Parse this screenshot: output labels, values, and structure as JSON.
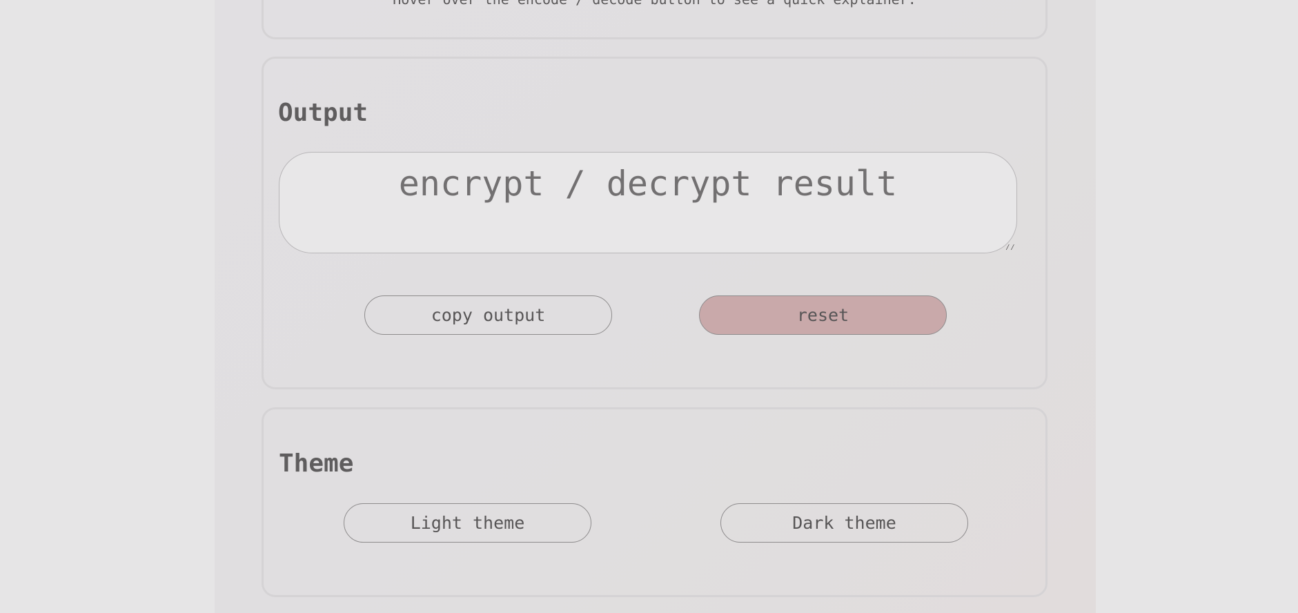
{
  "hint": {
    "text": "Hover over the encode / decode button to see a quick explainer."
  },
  "output": {
    "title": "Output",
    "placeholder": "encrypt / decrypt result",
    "copy_label": "copy output",
    "reset_label": "reset"
  },
  "theme": {
    "title": "Theme",
    "light_label": "Light theme",
    "dark_label": "Dark theme"
  },
  "colors": {
    "reset_button_bg": "#c9a9aa",
    "page_bg": "#e6e5e6"
  }
}
